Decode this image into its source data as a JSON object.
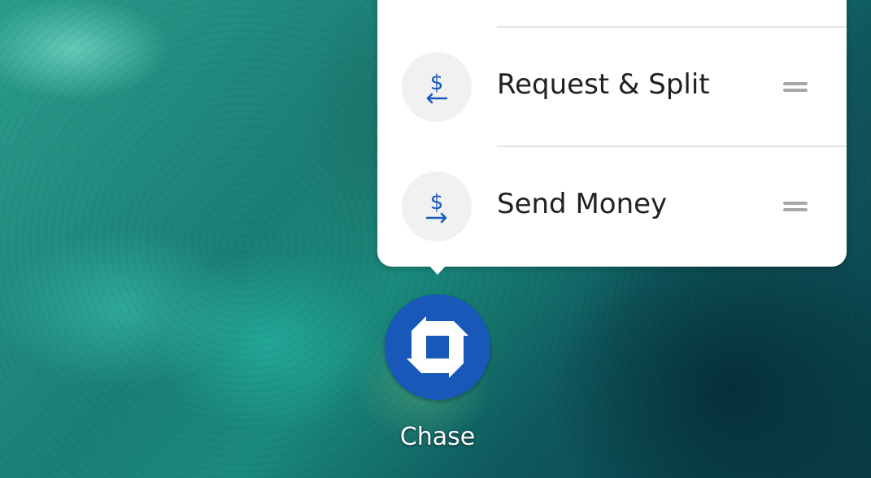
{
  "wallpaper": {
    "description_icon": "aerial-reef-wallpaper"
  },
  "shortcut_menu": {
    "items": [
      {
        "label": "",
        "icon": "partial-shortcut-icon"
      },
      {
        "label": "Request & Split",
        "icon": "dollar-request-icon"
      },
      {
        "label": "Send Money",
        "icon": "dollar-send-icon"
      }
    ],
    "drag_handle_icon": "drag-handle-icon"
  },
  "app": {
    "name": "Chase",
    "icon": "chase-logo-icon"
  },
  "colors": {
    "accent": "#1758b8",
    "menu_bg": "#ffffff",
    "icon_bg": "#f1f1f1",
    "text": "#202124",
    "handle": "#a8a8a8"
  }
}
